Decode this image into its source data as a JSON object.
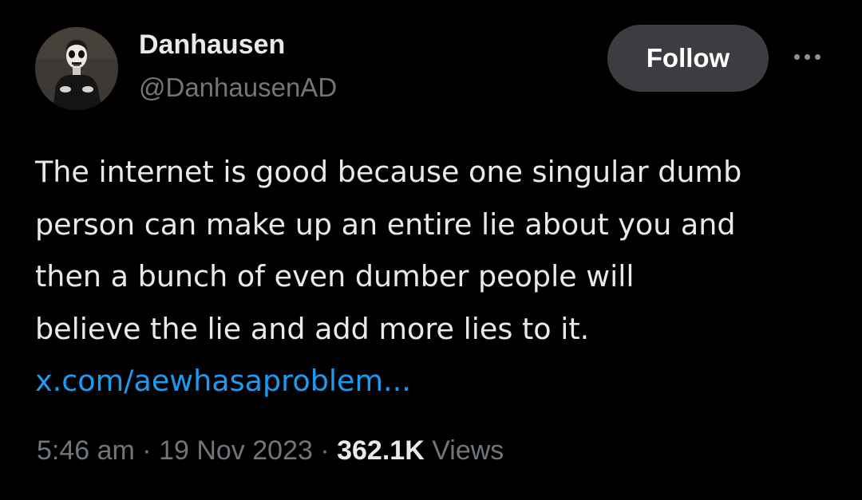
{
  "author": {
    "display_name": "Danhausen",
    "handle": "@DanhausenAD",
    "avatar_icon": "profile-photo"
  },
  "actions": {
    "follow_label": "Follow",
    "more_icon": "more-horizontal-icon"
  },
  "tweet": {
    "lines": [
      "The internet is good because one singular dumb",
      "person can make up an entire lie about you and",
      "then a bunch of even dumber people will",
      "believe the lie and add more lies to it."
    ],
    "link_text": "x.com/aewhasaproblem..."
  },
  "meta": {
    "time": "5:46 am",
    "separator": " · ",
    "date": "19 Nov 2023",
    "views_count": "362.1K",
    "views_label": " Views"
  },
  "colors": {
    "background": "#000000",
    "text_primary": "#e7e9ea",
    "text_secondary": "#71767b",
    "link": "#1d9bf0",
    "follow_button_bg": "#3b3d40"
  }
}
